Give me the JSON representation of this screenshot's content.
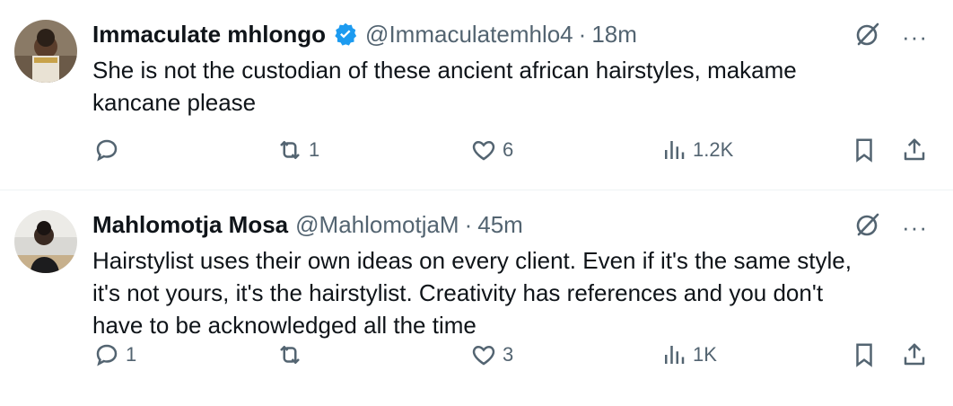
{
  "tweets": [
    {
      "name": "Immaculate mhlongo",
      "verified": true,
      "handle": "@Immaculatemhlo4",
      "separator": "·",
      "time": "18m",
      "text": "She is not the custodian of these ancient african hairstyles, makame\nkancane please",
      "replies": "",
      "retweets": "1",
      "likes": "6",
      "views": "1.2K"
    },
    {
      "name": "Mahlomotja Mosa",
      "verified": false,
      "handle": "@MahlomotjaM",
      "separator": "·",
      "time": "45m",
      "text": "Hairstylist uses their own ideas on every client. Even if it's the same style,\nit's not yours, it's the hairstylist. Creativity has references and you don't\nhave to be acknowledged all the time",
      "replies": "1",
      "retweets": "",
      "likes": "3",
      "views": "1K"
    }
  ],
  "more_label": "···",
  "colors": {
    "text": "#0f1419",
    "secondary": "#536471",
    "verified": "#1d9bf0",
    "divider": "#eff3f4"
  },
  "icons": [
    "verified-badge-icon",
    "grok-icon",
    "more-icon",
    "reply-icon",
    "retweet-icon",
    "like-icon",
    "views-icon",
    "bookmark-icon",
    "share-icon"
  ]
}
